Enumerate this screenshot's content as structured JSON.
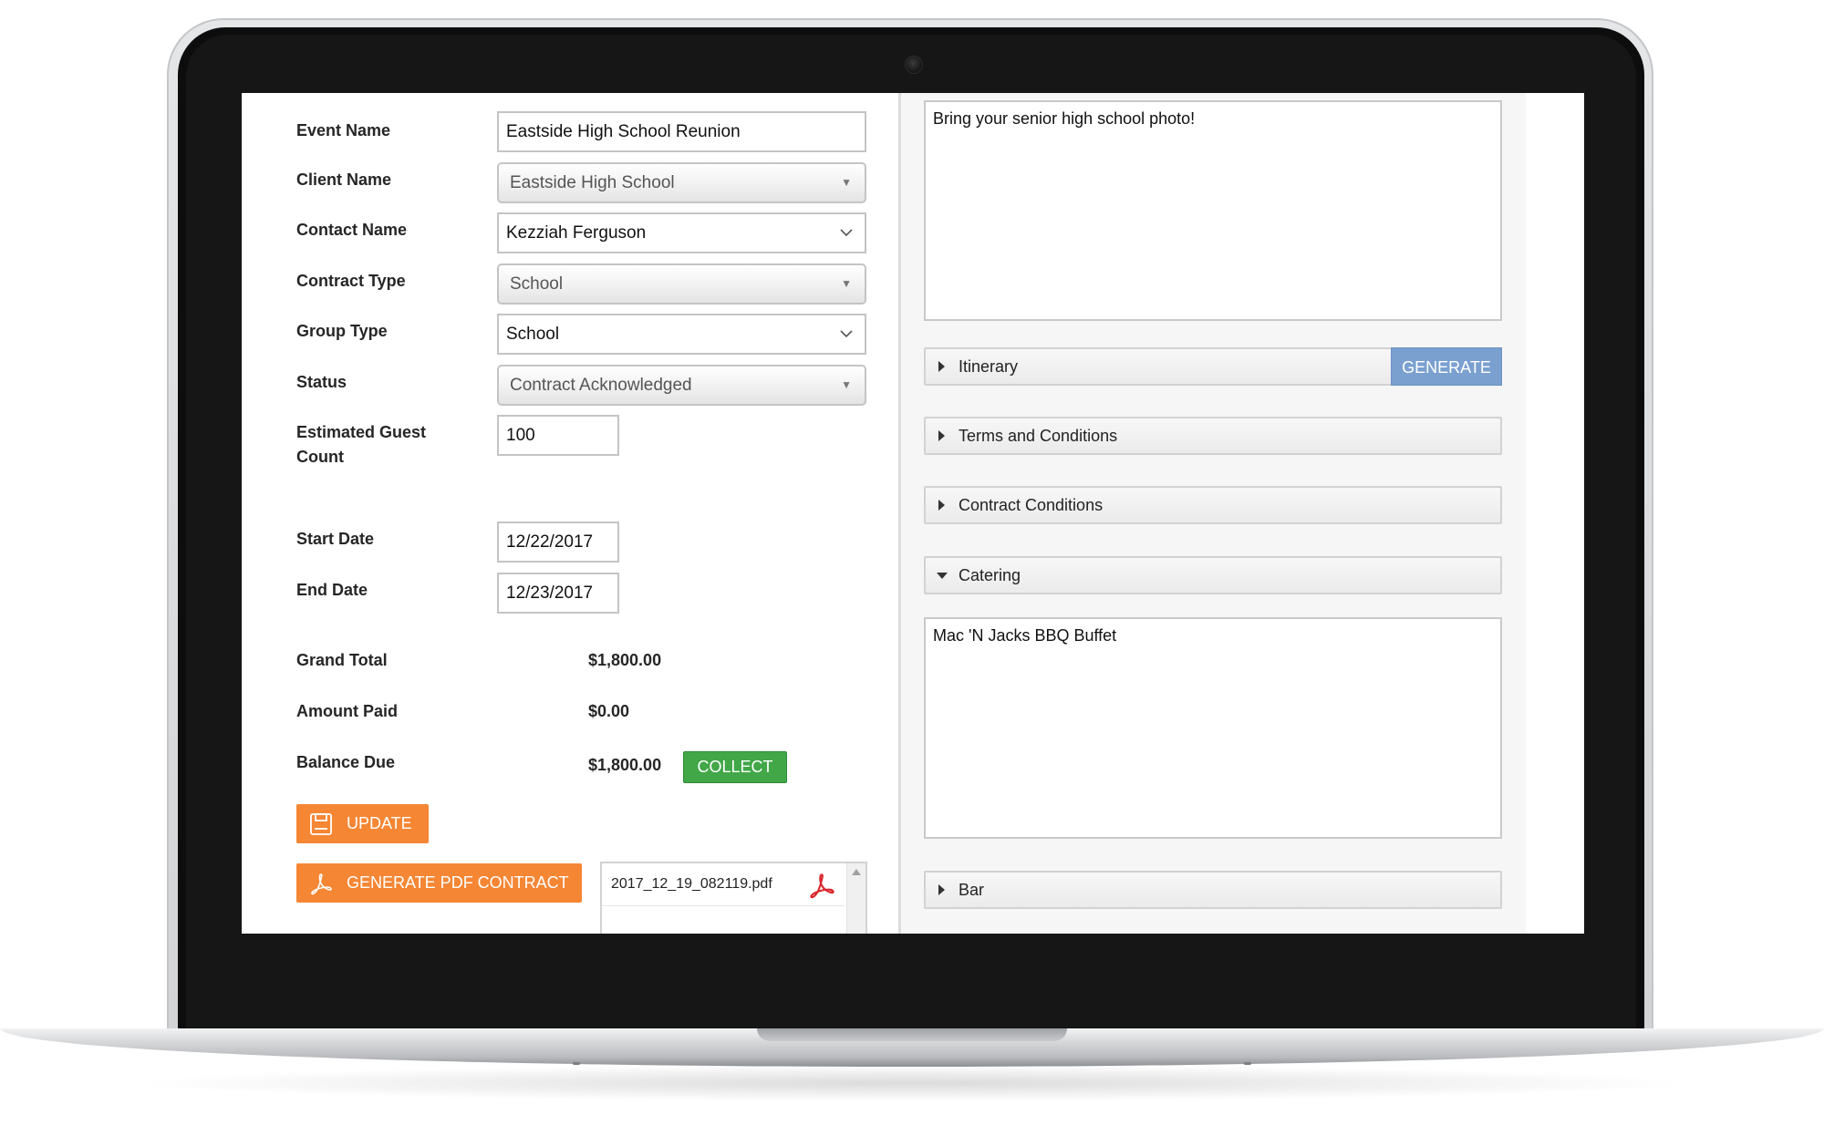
{
  "form": {
    "event_name": {
      "label": "Event Name",
      "value": "Eastside High School Reunion"
    },
    "client_name": {
      "label": "Client Name",
      "value": "Eastside High School"
    },
    "contact_name": {
      "label": "Contact Name",
      "value": "Kezziah Ferguson"
    },
    "contract_type": {
      "label": "Contract Type",
      "value": "School"
    },
    "group_type": {
      "label": "Group Type",
      "value": "School"
    },
    "status": {
      "label": "Status",
      "value": "Contract Acknowledged"
    },
    "guest_count": {
      "label_line1": "Estimated Guest",
      "label_line2": "Count",
      "value": "100"
    },
    "start_date": {
      "label": "Start Date",
      "value": "12/22/2017"
    },
    "end_date": {
      "label": "End Date",
      "value": "12/23/2017"
    }
  },
  "totals": {
    "grand_total": {
      "label": "Grand Total",
      "value": "$1,800.00"
    },
    "amount_paid": {
      "label": "Amount Paid",
      "value": "$0.00"
    },
    "balance_due": {
      "label": "Balance Due",
      "value": "$1,800.00"
    }
  },
  "buttons": {
    "collect": "COLLECT",
    "update": "UPDATE",
    "generate_pdf": "GENERATE PDF CONTRACT",
    "generate": "GENERATE"
  },
  "files": [
    {
      "name": "2017_12_19_082119.pdf"
    }
  ],
  "notes": {
    "description": "Bring your senior high school photo!"
  },
  "sections": {
    "itinerary": "Itinerary",
    "terms": "Terms and Conditions",
    "contract_conditions": "Contract Conditions",
    "catering": "Catering",
    "catering_text": "Mac 'N Jacks BBQ Buffet",
    "bar": "Bar"
  },
  "colors": {
    "accent_orange": "#f58634",
    "collect_green": "#41a747",
    "generate_blue": "#7aa0cf",
    "pdf_red": "#d9262b"
  }
}
